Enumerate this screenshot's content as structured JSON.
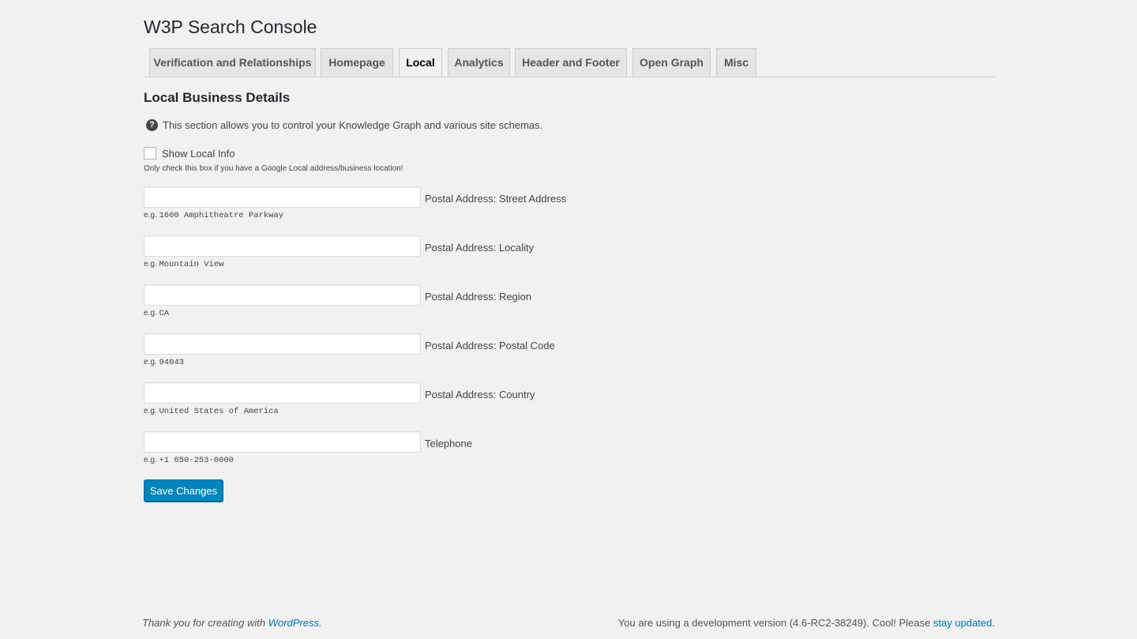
{
  "page": {
    "title": "W3P Search Console"
  },
  "tabs": [
    {
      "label": "Verification and Relationships",
      "active": false
    },
    {
      "label": "Homepage",
      "active": false
    },
    {
      "label": "Local",
      "active": true
    },
    {
      "label": "Analytics",
      "active": false
    },
    {
      "label": "Header and Footer",
      "active": false
    },
    {
      "label": "Open Graph",
      "active": false
    },
    {
      "label": "Misc",
      "active": false
    }
  ],
  "section": {
    "title": "Local Business Details",
    "info_icon": "question-circle-icon",
    "info_text": "This section allows you to control your Knowledge Graph and various site schemas.",
    "checkbox_label": "Show Local Info",
    "checkbox_checked": false,
    "checkbox_description": "Only check this box if you have a Google Local address/business location!"
  },
  "fields": [
    {
      "label": "Postal Address: Street Address",
      "value": "",
      "hint_prefix": "e.g.",
      "hint_example": "1600 Amphitheatre Parkway"
    },
    {
      "label": "Postal Address: Locality",
      "value": "",
      "hint_prefix": "e.g.",
      "hint_example": "Mountain View"
    },
    {
      "label": "Postal Address: Region",
      "value": "",
      "hint_prefix": "e.g.",
      "hint_example": "CA"
    },
    {
      "label": "Postal Address: Postal Code",
      "value": "",
      "hint_prefix": "e.g.",
      "hint_example": "94043"
    },
    {
      "label": "Postal Address: Country",
      "value": "",
      "hint_prefix": "e.g.",
      "hint_example": "United States of America"
    },
    {
      "label": "Telephone",
      "value": "",
      "hint_prefix": "e.g.",
      "hint_example": "+1 650-253-0000"
    }
  ],
  "actions": {
    "save_label": "Save Changes"
  },
  "footer": {
    "left_text": "Thank you for creating with ",
    "left_link": "WordPress",
    "left_suffix": ".",
    "right_text": "You are using a development version (4.6-RC2-38249). Cool! Please ",
    "right_link": "stay updated",
    "right_suffix": "."
  },
  "colors": {
    "background": "#f1f1f1",
    "primary_button": "#0085ba",
    "link": "#0073aa"
  }
}
